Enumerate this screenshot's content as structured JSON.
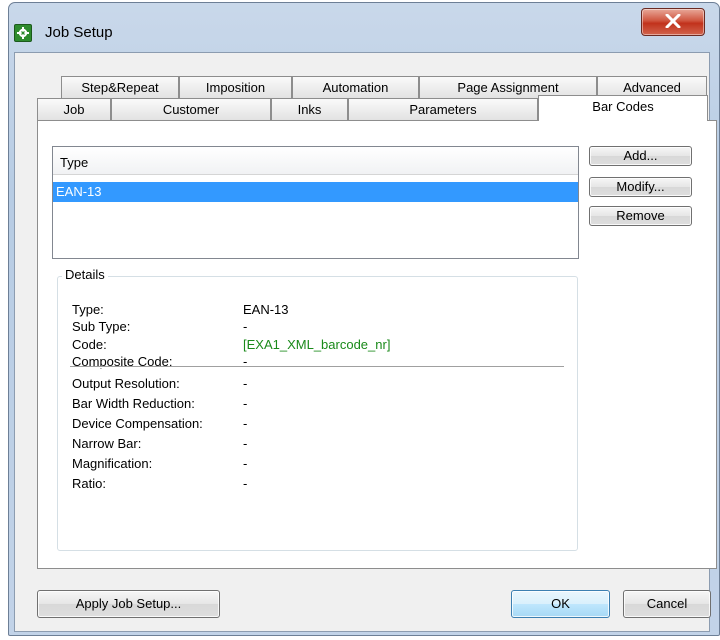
{
  "window": {
    "title": "Job Setup",
    "close_glyph": "X"
  },
  "tabs_row1": [
    "Step&Repeat",
    "Imposition",
    "Automation",
    "Page Assignment",
    "Advanced"
  ],
  "tabs_row2": [
    "Job",
    "Customer",
    "Inks",
    "Parameters",
    "Bar Codes"
  ],
  "active_tab": "Bar Codes",
  "list": {
    "header": "Type",
    "rows": [
      "EAN-13"
    ],
    "selected_row": 0
  },
  "side_buttons": {
    "add": "Add...",
    "modify": "Modify...",
    "remove": "Remove"
  },
  "details": {
    "title": "Details",
    "rows": [
      {
        "label": "Type:",
        "value": "EAN-13"
      },
      {
        "label": "Sub Type:",
        "value": "-"
      },
      {
        "label": "Code:",
        "value": "[EXA1_XML_barcode_nr]"
      },
      {
        "label": "Composite Code:",
        "value": "-"
      },
      {
        "label": "Output Resolution:",
        "value": "-"
      },
      {
        "label": "Bar Width Reduction:",
        "value": "-"
      },
      {
        "label": "Device Compensation:",
        "value": "-"
      },
      {
        "label": "Narrow Bar:",
        "value": "-"
      },
      {
        "label": "Magnification:",
        "value": "-"
      },
      {
        "label": "Ratio:",
        "value": "-"
      }
    ]
  },
  "footer": {
    "apply": "Apply Job Setup...",
    "ok": "OK",
    "cancel": "Cancel"
  },
  "colors": {
    "selection": "#3399ff",
    "code_value": "#1a8a1a",
    "titlebar": "#b7cce4"
  }
}
